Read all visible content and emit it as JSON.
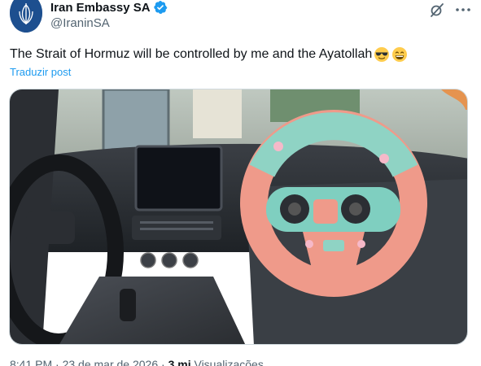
{
  "author": {
    "display_name": "Iran Embassy SA",
    "handle": "@IraninSA",
    "verified": true,
    "avatar_icon": "embassy-emblem-icon"
  },
  "actions": {
    "grok_icon": "grok-icon",
    "more_icon": "more-options-icon"
  },
  "tweet": {
    "text": "The Strait of Hormuz will be controlled by me and the Ayatollah",
    "emojis": [
      "smiling-face-with-sunglasses",
      "grinning-face-with-smiling-eyes"
    ],
    "translate_label": "Traduzir post"
  },
  "media": {
    "description_icon": "photo-toy-steering-wheel-in-car"
  },
  "meta": {
    "time": "8:41 PM",
    "separator": " · ",
    "date": "23 de mar de 2026",
    "views_count": "3 mi",
    "views_label": "Visualizações"
  },
  "colors": {
    "accent": "#1d9bf0",
    "text": "#0f1419",
    "secondary": "#536471",
    "border": "#cfd9de"
  }
}
